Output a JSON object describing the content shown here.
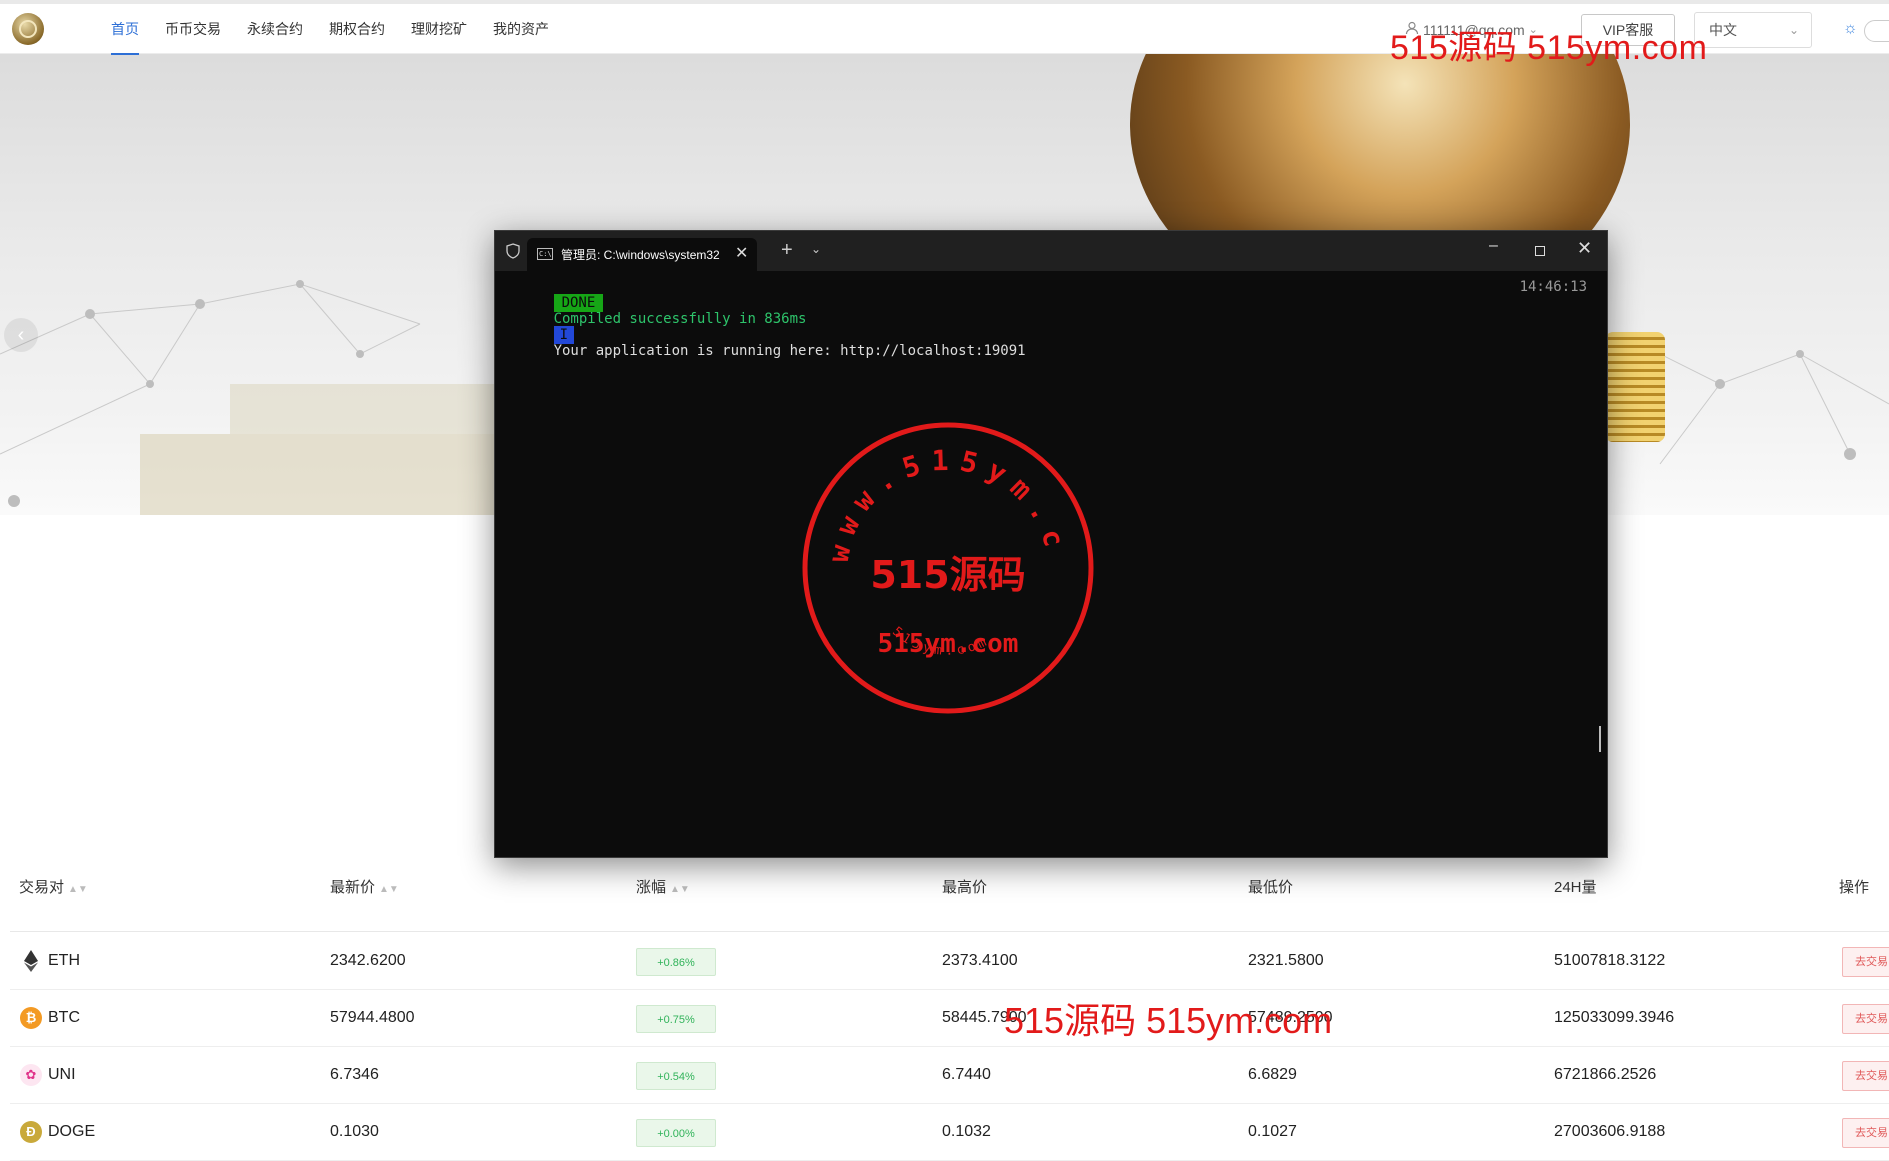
{
  "watermark": "515源码 515ym.com",
  "nav": {
    "items": [
      "首页",
      "币币交易",
      "永续合约",
      "期权合约",
      "理财挖矿",
      "我的资产"
    ],
    "user": "111111@qq.com",
    "vip_label": "VIP客服",
    "language": "中文"
  },
  "terminal": {
    "tab_title": "管理员: C:\\windows\\system32",
    "done_badge": "DONE",
    "done_text": "Compiled successfully in 836ms",
    "time": "14:46:13",
    "info_badge": "I",
    "info_text": "Your application is running here: http://localhost:19091"
  },
  "seal": {
    "ring_text": "www.515ym.com",
    "center_text": "515源码",
    "url_text": "515ym.com",
    "bottom_text": "515ym.com"
  },
  "table": {
    "headers": [
      "交易对",
      "最新价",
      "涨幅",
      "最高价",
      "最低价",
      "24H量",
      "操作"
    ],
    "rows": [
      {
        "pair": "ETH",
        "price": "2342.6200",
        "change": "+0.86%",
        "high": "2373.4100",
        "low": "2321.5800",
        "volume": "51007818.3122",
        "action": "去交易"
      },
      {
        "pair": "BTC",
        "price": "57944.4800",
        "change": "+0.75%",
        "high": "58445.7900",
        "low": "57489.2500",
        "volume": "125033099.3946",
        "action": "去交易"
      },
      {
        "pair": "UNI",
        "price": "6.7346",
        "change": "+0.54%",
        "high": "6.7440",
        "low": "6.6829",
        "volume": "6721866.2526",
        "action": "去交易"
      },
      {
        "pair": "DOGE",
        "price": "0.1030",
        "change": "+0.00%",
        "high": "0.1032",
        "low": "0.1027",
        "volume": "27003606.9188",
        "action": "去交易"
      }
    ]
  },
  "colors": {
    "accent": "#2d6fd6",
    "rise": "#31b35a",
    "watermark": "#e21a1a",
    "trade": "#e05a5a"
  }
}
